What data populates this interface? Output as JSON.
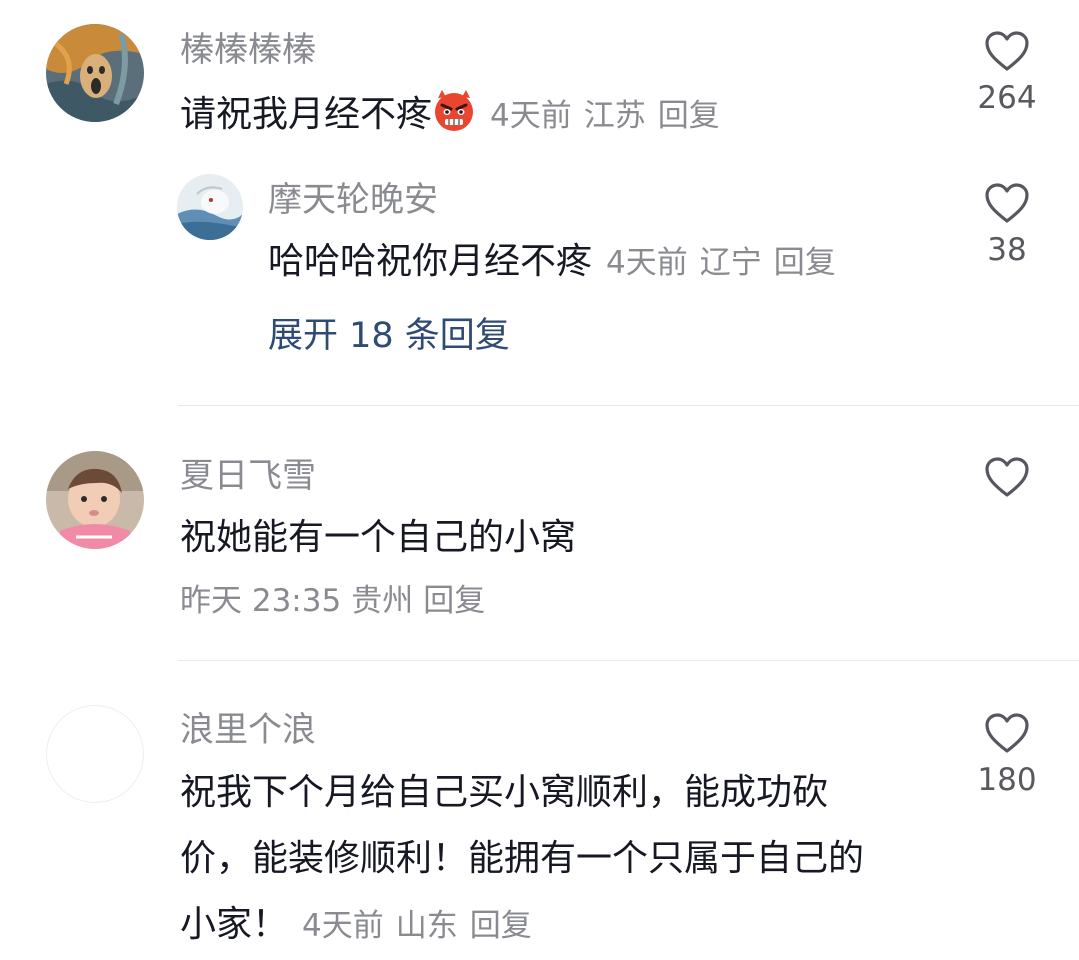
{
  "comments": [
    {
      "user": "榛榛榛榛",
      "text": "请祝我月经不疼",
      "emoji": "angry-face-emoji",
      "time": "4天前",
      "location": "江苏",
      "reply_label": "回复",
      "likes": "264",
      "replies": [
        {
          "user": "摩天轮晚安",
          "text": "哈哈哈祝你月经不疼",
          "time": "4天前",
          "location": "辽宁",
          "reply_label": "回复",
          "likes": "38"
        }
      ],
      "expand_label": "展开 18 条回复"
    },
    {
      "user": "夏日飞雪",
      "text": "祝她能有一个自己的小窝",
      "time": "昨天 23:35",
      "location": "贵州",
      "reply_label": "回复",
      "likes": ""
    },
    {
      "user": "浪里个浪",
      "text_lines": [
        "祝我下个月给自己买小窝顺利，能成功砍",
        "价，能装修顺利！能拥有一个只属于自己的",
        "小家！"
      ],
      "time": "4天前",
      "location": "山东",
      "reply_label": "回复",
      "likes": "180"
    }
  ],
  "colors": {
    "username": "#8a8b91",
    "text": "#161823",
    "link": "#2f4b73",
    "divider": "#e9e9ea"
  }
}
